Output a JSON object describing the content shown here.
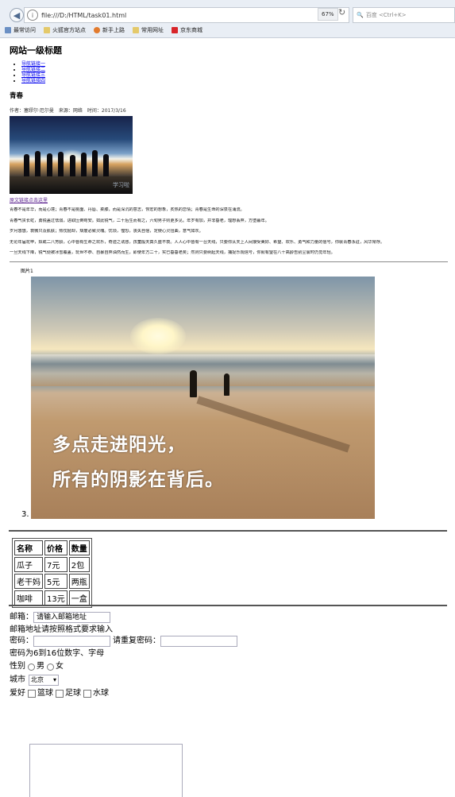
{
  "browser": {
    "url": "file:///D:/HTML/task01.html",
    "zoom": "67%",
    "search_placeholder": "百度 <Ctrl+K>",
    "bookmarks": [
      "最常访问",
      "火狐官方站点",
      "新手上路",
      "常用网址",
      "京东商城"
    ]
  },
  "page": {
    "title": "网站一级标题",
    "nav_links": [
      "导航链接一",
      "导航链接二",
      "导航链接三",
      "导航链接四"
    ],
    "article_title": "青春",
    "meta": "作者：塞缪尔·厄尔曼　来源：网络　时间：2017/3/16",
    "source_link": "原文链接点击这里",
    "paragraphs": [
      "青春不是年华，而是心境；青春不是桃面、丹唇、柔膝，而是深沉的意志，恢宏的想象，炙热的恋情；青春是生命的深泉在涌流。",
      "青春气贯长虹，勇锐盖过怯弱，进取压倒苟安。如此锐气，二十后生而有之，六旬男子则更多见。年岁有加，并非垂老，理想丢弃，方堕暮年。",
      "岁月悠悠，衰微只及肌肤；热忱抛却，颓废必致灵魂。忧烦，惶恐，丧失自信，定使心灵扭曲，意气如灰。",
      "无论年届花甲，拟或二八芳龄，心中皆有生命之欢乐，奇迹之诱惑，孩童般天真久盛不衰。人人心中皆有一台天线，只要你从天上人间接受美好、希望、欢乐、勇气和力量的信号，你就青春永驻，风华常存。",
      "一旦天线下降，锐气便被冰雪覆盖，玩世不恭、自暴自弃油然而生，即使年方二十，实已垂垂老矣；然则只要树起天线，捕捉乐观信号，你就有望在八十高龄告别尘寰时仍觉年轻。"
    ],
    "photo1_watermark": "学习啦",
    "figure_caption": "图片1",
    "photo2_line1": "多点走进阳光，",
    "photo2_line2": "所有的阴影在背后。",
    "list_marker": "3."
  },
  "goods_table": {
    "headers": [
      "名称",
      "价格",
      "数量"
    ],
    "rows": [
      [
        "瓜子",
        "7元",
        "2包"
      ],
      [
        "老干妈",
        "5元",
        "两瓶"
      ],
      [
        "咖啡",
        "13元",
        "一盒"
      ]
    ]
  },
  "form": {
    "email_label": "邮箱：",
    "email_placeholder": "请输入邮箱地址",
    "email_hint": "邮箱地址请按照格式要求输入",
    "password_label": "密码：",
    "confirm_label": "请重复密码：",
    "password_hint": "密码为6到16位数字、字母",
    "gender_label": "性别",
    "gender_options": [
      "男",
      "女"
    ],
    "city_label": "城市",
    "city_value": "北京",
    "hobby_label": "爱好",
    "hobby_options": [
      "篮球",
      "足球",
      "水球"
    ]
  }
}
